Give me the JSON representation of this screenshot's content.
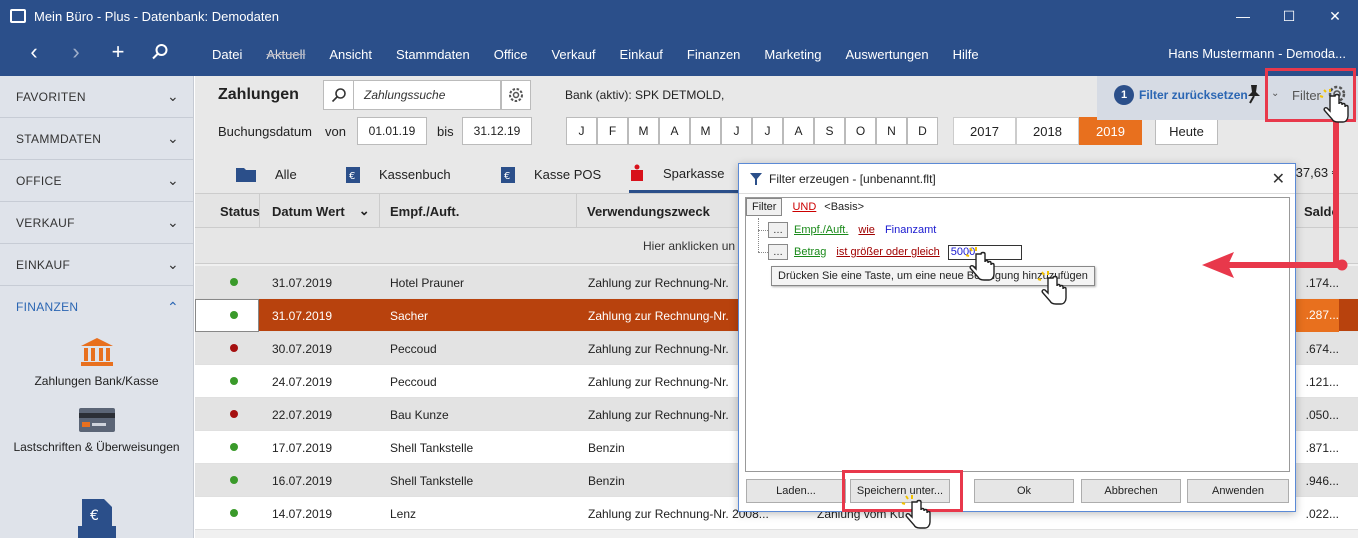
{
  "window": {
    "title": "Mein Büro - Plus - Datenbank: Demodaten",
    "minimize": "—",
    "maximize": "☐",
    "close": "✕"
  },
  "nav": {
    "back": "‹",
    "forward": "›",
    "add": "+",
    "menu": [
      "Datei",
      "Aktuell",
      "Ansicht",
      "Stammdaten",
      "Office",
      "Verkauf",
      "Einkauf",
      "Finanzen",
      "Marketing",
      "Auswertungen",
      "Hilfe"
    ],
    "user": "Hans Mustermann - Demoda..."
  },
  "sidebar": {
    "sections": [
      "FAVORITEN",
      "STAMMDATEN",
      "OFFICE",
      "VERKAUF",
      "EINKAUF"
    ],
    "open_section": "FINANZEN",
    "items": [
      "Zahlungen Bank/Kasse",
      "Lastschriften & Überweisungen"
    ]
  },
  "header": {
    "title": "Zahlungen",
    "search_placeholder": "Zahlungssuche",
    "bank": "Bank (aktiv): SPK DETMOLD,",
    "date_label": "Buchungsdatum",
    "from_label": "von",
    "from": "01.01.19",
    "to_label": "bis",
    "to": "31.12.19",
    "months": [
      "J",
      "F",
      "M",
      "A",
      "M",
      "J",
      "J",
      "A",
      "S",
      "O",
      "N",
      "D"
    ],
    "years": [
      "2017",
      "2018",
      "2019"
    ],
    "selected_year": "2019",
    "today": "Heute",
    "filter_badge": "1",
    "filter_reset": "Filter zurücksetzen",
    "filter_label": "Filter"
  },
  "tabs": [
    "Alle",
    "Kassenbuch",
    "Kasse POS",
    "Sparkasse"
  ],
  "partial_amount_top": "37,63 €",
  "columns": [
    "Status",
    "Datum Wert",
    "Empf./Auft.",
    "Verwendungszweck",
    "Saldo"
  ],
  "add_row_text": "Hier anklicken un",
  "rows": [
    {
      "status": "green",
      "date": "31.07.2019",
      "party": "Hotel Prauner",
      "purpose": "Zahlung zur Rechnung-Nr.",
      "saldo": ".174..."
    },
    {
      "status": "green",
      "date": "31.07.2019",
      "party": "Sacher",
      "purpose": "Zahlung zur Rechnung-Nr.",
      "saldo": ".287..."
    },
    {
      "status": "red",
      "date": "30.07.2019",
      "party": "Peccoud",
      "purpose": "Zahlung zur Rechnung-Nr.",
      "saldo": ".674..."
    },
    {
      "status": "green",
      "date": "24.07.2019",
      "party": "Peccoud",
      "purpose": "Zahlung zur Rechnung-Nr.",
      "saldo": ".121..."
    },
    {
      "status": "red",
      "date": "22.07.2019",
      "party": "Bau Kunze",
      "purpose": "Zahlung zur Rechnung-Nr.",
      "saldo": ".050..."
    },
    {
      "status": "green",
      "date": "17.07.2019",
      "party": "Shell Tankstelle",
      "purpose": "Benzin",
      "saldo": ".871..."
    },
    {
      "status": "green",
      "date": "16.07.2019",
      "party": "Shell Tankstelle",
      "purpose": "Benzin",
      "saldo": ".946..."
    },
    {
      "status": "green",
      "date": "14.07.2019",
      "party": "Lenz",
      "purpose": "Zahlung zur Rechnung-Nr. 2008...",
      "saldo": ".022..."
    }
  ],
  "dialog": {
    "title": "Filter erzeugen - [unbenannt.flt]",
    "filter_btn": "Filter",
    "operator": "UND",
    "basis": "<Basis>",
    "cond1": {
      "field": "Empf./Auft.",
      "op": "wie",
      "value": "Finanzamt"
    },
    "cond2": {
      "field": "Betrag",
      "op": "ist größer oder gleich",
      "value": "5000"
    },
    "hint": "Drücken Sie eine Taste, um eine neue Bedingung hinzuzufügen",
    "buttons": [
      "Laden...",
      "Speichern unter...",
      "Ok",
      "Abbrechen",
      "Anwenden"
    ],
    "bg_text": "Zahlung vom Ku"
  },
  "colors": {
    "titlebar": "#2b4f8a",
    "accent": "#e8701e",
    "selected_row": "#b8420d",
    "annotation": "#e8384b"
  }
}
